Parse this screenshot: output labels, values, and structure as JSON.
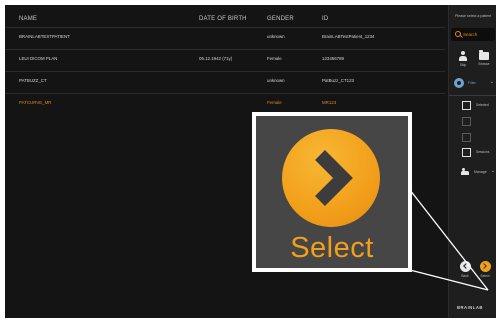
{
  "table": {
    "columns": {
      "name": "NAME",
      "dob": "DATE OF BIRTH",
      "gender": "GENDER",
      "id": "ID"
    },
    "rows": [
      {
        "name": "BRAINLABTESTPATIENT",
        "dob": "",
        "gender": "unknown",
        "id": "BrainLABTestPatient_1234",
        "selected": false
      },
      {
        "name": "LEUI DICOM PLAN",
        "dob": "05.12.1942 (71y)",
        "gender": "Female",
        "id": "123456789",
        "selected": false
      },
      {
        "name": "PATBUZZ_CT",
        "dob": "",
        "gender": "unknown",
        "id": "PatBuzz_CT123",
        "selected": false
      },
      {
        "name": "PATCURVE_MR",
        "dob": "",
        "gender": "Female",
        "id": "MR123",
        "selected": true
      }
    ]
  },
  "sidebar": {
    "prompt": "Please select a patient",
    "search_placeholder": "Search",
    "tools": [
      {
        "label": "Skip",
        "icon": "person-icon"
      },
      {
        "label": "Browse",
        "icon": "folder-icon"
      }
    ],
    "filter_label": "Filter",
    "options": [
      {
        "label": "Selected",
        "dim": false
      },
      {
        "label": "",
        "dim": true
      },
      {
        "label": "",
        "dim": true
      },
      {
        "label": "Sessions",
        "dim": false
      }
    ],
    "manage_label": "Manage",
    "back_label": "Back",
    "select_label": "Select",
    "logo": "BRAINLAB"
  },
  "callout": {
    "label": "Select"
  },
  "colors": {
    "accent": "#f29f1b",
    "background": "#141414",
    "selected_row_text": "#e08a1e"
  }
}
